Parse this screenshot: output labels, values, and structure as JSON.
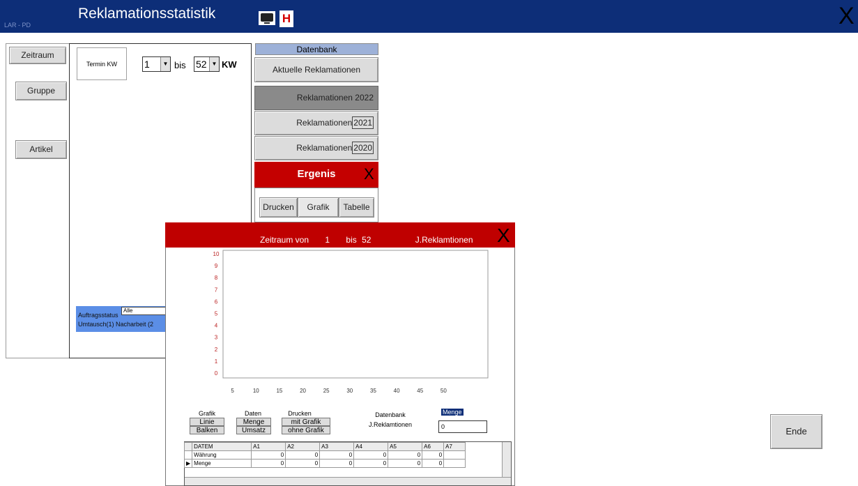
{
  "app": {
    "tag": "LAR - PD",
    "title": "Reklamationsstatistik",
    "h_button": "H",
    "close": "X"
  },
  "left_nav": {
    "zeitraum": "Zeitraum",
    "gruppe": "Gruppe",
    "artikel": "Artikel"
  },
  "filter": {
    "termin_label": "Termin KW",
    "kw_from": "1",
    "bis": "bis",
    "kw_to": "52",
    "kw": "KW",
    "auftragsstatus_label": "Auftragsstatus",
    "auftragsstatus_value": "Alle",
    "auftragsstatus_hint": "Umtausch(1) Nacharbeit (2"
  },
  "database": {
    "header": "Datenbank",
    "aktuelle": "Aktuelle Reklamationen",
    "rows": [
      {
        "label": "Reklamationen",
        "year": "2022"
      },
      {
        "label": "Reklamationen",
        "year": "2021"
      },
      {
        "label": "Reklamationen",
        "year": "2020"
      }
    ]
  },
  "ergebnis": {
    "title": "Ergenis",
    "close": "X",
    "drucken": "Drucken",
    "grafik": "Grafik",
    "tabelle": "Tabelle"
  },
  "chart_window": {
    "title_prefix": "Zeitraum von",
    "from": "1",
    "bis": "bis",
    "to": "52",
    "subject": "J.Reklamtionen",
    "close": "X"
  },
  "chart_data": {
    "type": "bar",
    "title": "",
    "xlabel": "",
    "ylabel": "",
    "ylim": [
      0,
      10
    ],
    "y_ticks": [
      "0",
      "1",
      "2",
      "3",
      "4",
      "5",
      "6",
      "7",
      "8",
      "9",
      "10"
    ],
    "x_ticks": [
      "5",
      "10",
      "15",
      "20",
      "25",
      "30",
      "35",
      "40",
      "45",
      "50"
    ],
    "series": []
  },
  "controls": {
    "grafik_label": "Grafik",
    "daten_label": "Daten",
    "drucken_label": "Drucken",
    "linie": "Linie",
    "balken": "Balken",
    "menge": "Menge",
    "umsatz": "Umsatz",
    "mit_grafik": "mit Grafik",
    "ohne_grafik": "ohne Grafik",
    "datenbank_label": "Datenbank",
    "datenbank_value": "J.Reklamtionen",
    "menge_tag": "Menge",
    "menge_value": "0"
  },
  "grid": {
    "columns": [
      "DATEM",
      "A1",
      "A2",
      "A3",
      "A4",
      "A5",
      "A6",
      "A7"
    ],
    "rows": [
      {
        "label": "Währung",
        "values": [
          "0",
          "0",
          "0",
          "0",
          "0",
          "0"
        ]
      },
      {
        "label": "Menge",
        "values": [
          "0",
          "0",
          "0",
          "0",
          "0",
          "0"
        ]
      }
    ]
  },
  "ende": "Ende"
}
